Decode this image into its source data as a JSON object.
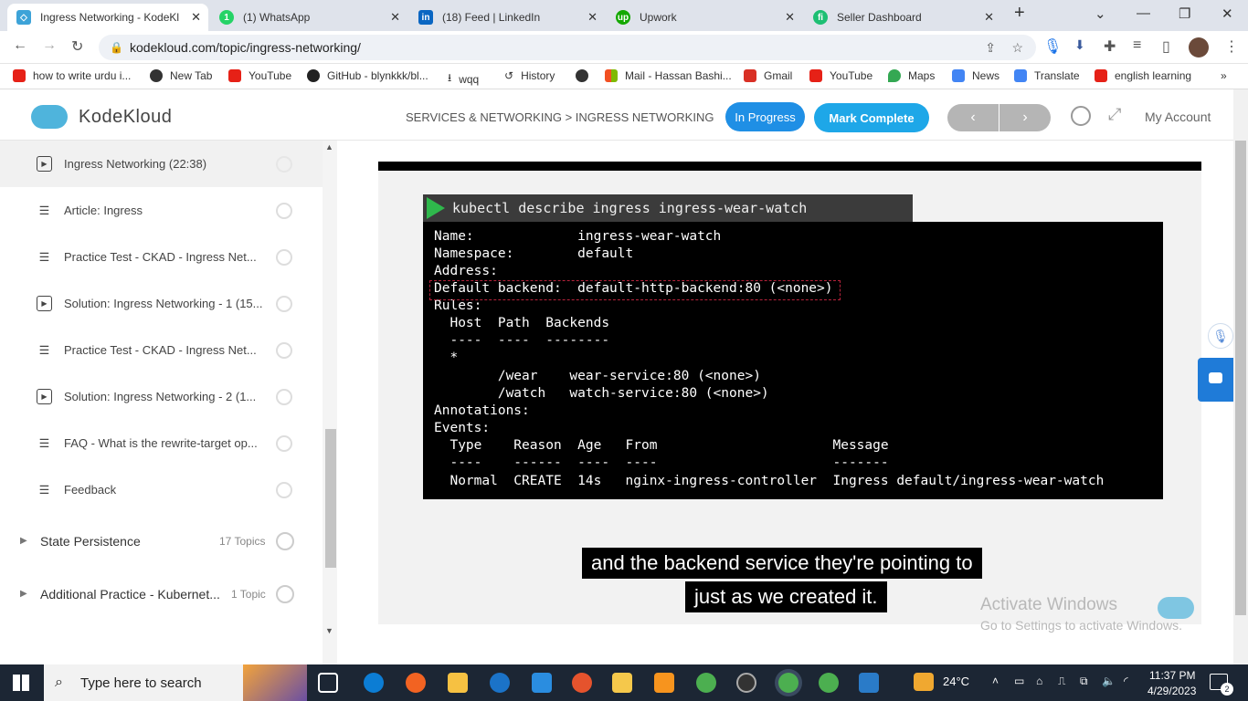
{
  "browser": {
    "tabs": [
      {
        "title": "Ingress Networking - KodeKl",
        "color": "#3da3d8"
      },
      {
        "title": "(1) WhatsApp",
        "color": "#25d366"
      },
      {
        "title": "(18) Feed | LinkedIn",
        "color": "#0a66c2"
      },
      {
        "title": "Upwork",
        "color": "#14a800"
      },
      {
        "title": "Seller Dashboard",
        "color": "#1dbf73"
      }
    ],
    "new_tab": "+",
    "url": "kodekloud.com/topic/ingress-networking/",
    "bookmarks": [
      {
        "label": "how to write urdu i...",
        "color": "#e62117"
      },
      {
        "label": "New Tab",
        "color": "#333"
      },
      {
        "label": "YouTube",
        "color": "#e62117"
      },
      {
        "label": "GitHub - blynkkk/bl...",
        "color": "#222"
      },
      {
        "label": "wqq",
        "color": "#555"
      },
      {
        "label": "History",
        "color": "#555"
      },
      {
        "label": "",
        "color": "#333"
      },
      {
        "label": "Mail - Hassan Bashi...",
        "color": "#f25022"
      },
      {
        "label": "Gmail",
        "color": "#d93025"
      },
      {
        "label": "YouTube",
        "color": "#e62117"
      },
      {
        "label": "Maps",
        "color": "#34a853"
      },
      {
        "label": "News",
        "color": "#4285f4"
      },
      {
        "label": "Translate",
        "color": "#4285f4"
      },
      {
        "label": "english learning",
        "color": "#e62117"
      }
    ]
  },
  "header": {
    "logo": "KodeKloud",
    "breadcrumb": "SERVICES & NETWORKING > INGRESS NETWORKING",
    "status_btn": "In Progress",
    "complete_btn": "Mark Complete",
    "prev": "‹",
    "next": "›",
    "account": "My Account",
    "accent": "#1f8fe5",
    "accent2": "#1ea7e8"
  },
  "sidebar": {
    "items": [
      {
        "label": "Ingress Networking (22:38)",
        "icon": "play-icon",
        "active": true
      },
      {
        "label": "Article: Ingress",
        "icon": "article-icon"
      },
      {
        "label": "Practice Test - CKAD - Ingress Net...",
        "icon": "article-icon"
      },
      {
        "label": "Solution: Ingress Networking - 1 (15...",
        "icon": "play-icon"
      },
      {
        "label": "Practice Test - CKAD - Ingress Net...",
        "icon": "article-icon"
      },
      {
        "label": "Solution: Ingress Networking - 2 (1...",
        "icon": "play-icon"
      },
      {
        "label": "FAQ - What is the rewrite-target op...",
        "icon": "article-icon"
      },
      {
        "label": "Feedback",
        "icon": "article-icon"
      }
    ],
    "sections": [
      {
        "label": "State Persistence",
        "count": "17 Topics"
      },
      {
        "label": "Additional Practice - Kubernet...",
        "count": "1 Topic"
      }
    ]
  },
  "video": {
    "command": "kubectl describe ingress ingress-wear-watch",
    "lines": [
      "Name:             ingress-wear-watch",
      "Namespace:        default",
      "Address:",
      "Default backend:  default-http-backend:80 (<none>)",
      "Rules:",
      "  Host  Path  Backends",
      "  ----  ----  --------",
      "  *",
      "        /wear    wear-service:80 (<none>)",
      "        /watch   watch-service:80 (<none>)",
      "Annotations:",
      "Events:",
      "  Type    Reason  Age   From                      Message",
      "  ----    ------  ----  ----                      -------",
      "  Normal  CREATE  14s   nginx-ingress-controller  Ingress default/ingress-wear-watch"
    ],
    "caption1": "and the backend service they're pointing to",
    "caption2": "just as we created it.",
    "watermark1": "Activate Windows",
    "watermark2": "Go to Settings to activate Windows."
  },
  "taskbar": {
    "search": "Type here to search",
    "temp": "24°C",
    "time": "11:37 PM",
    "date": "4/29/2023",
    "notif": "2"
  }
}
